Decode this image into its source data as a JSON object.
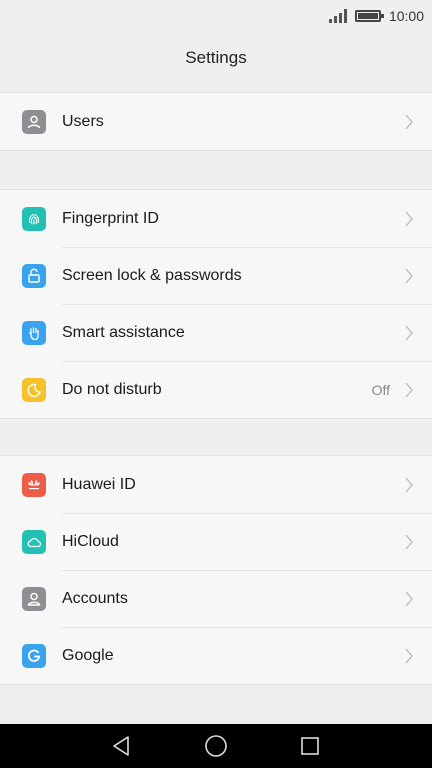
{
  "status_bar": {
    "time": "10:00"
  },
  "header": {
    "title": "Settings"
  },
  "groups": [
    {
      "items": [
        {
          "label": "Users",
          "icon": "user-icon",
          "color": "#8e8e93"
        }
      ]
    },
    {
      "items": [
        {
          "label": "Fingerprint ID",
          "icon": "fingerprint-icon",
          "color": "#22c1b4"
        },
        {
          "label": "Screen lock & passwords",
          "icon": "lock-icon",
          "color": "#3aa3ee"
        },
        {
          "label": "Smart assistance",
          "icon": "hand-icon",
          "color": "#3aa3ee"
        },
        {
          "label": "Do not disturb",
          "icon": "moon-icon",
          "color": "#f6c22b",
          "value": "Off"
        }
      ]
    },
    {
      "items": [
        {
          "label": "Huawei ID",
          "icon": "huawei-icon",
          "color": "#ec5c47"
        },
        {
          "label": "HiCloud",
          "icon": "cloud-icon",
          "color": "#22c1b4"
        },
        {
          "label": "Accounts",
          "icon": "account-icon",
          "color": "#8e8e93"
        },
        {
          "label": "Google",
          "icon": "google-icon",
          "color": "#3aa3ee"
        }
      ]
    }
  ],
  "nav": {
    "back": "back-icon",
    "home": "home-icon",
    "recents": "recents-icon"
  }
}
